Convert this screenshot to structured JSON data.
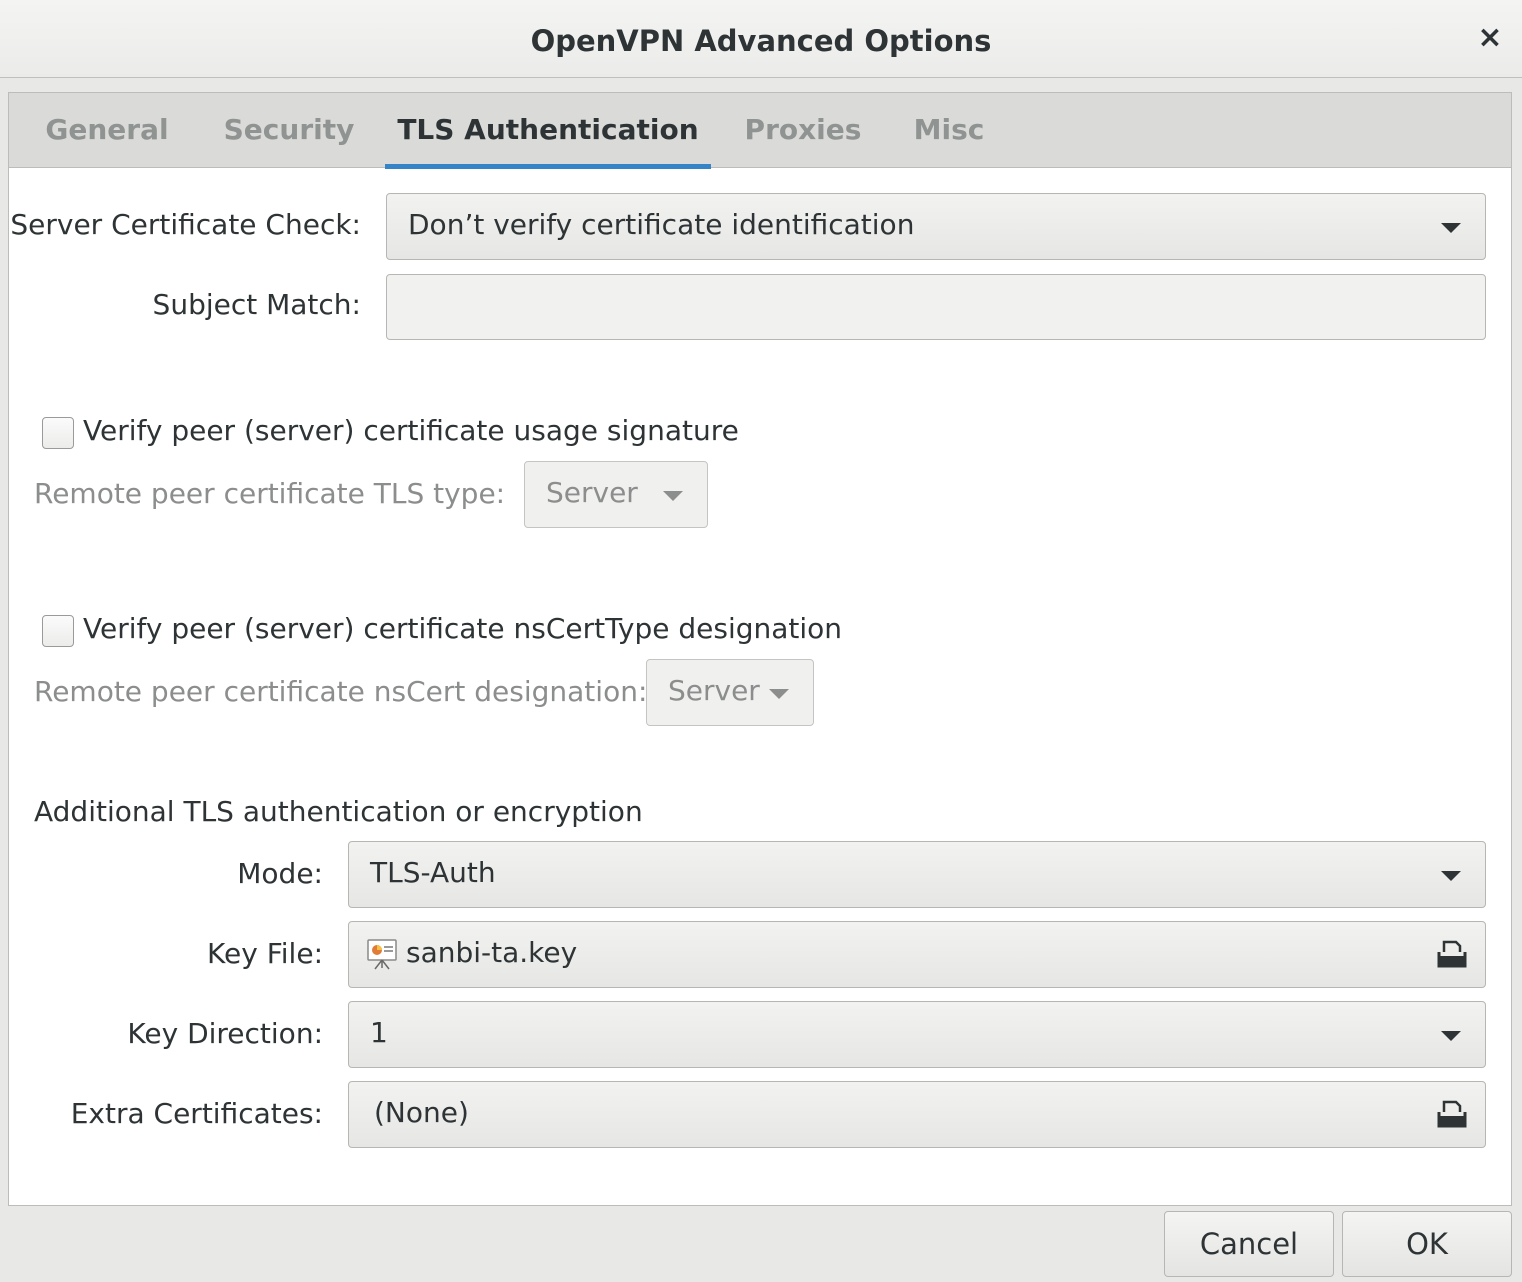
{
  "window": {
    "title": "OpenVPN Advanced Options",
    "close_glyph": "×"
  },
  "tabs": [
    {
      "label": "General",
      "active": false
    },
    {
      "label": "Security",
      "active": false
    },
    {
      "label": "TLS Authentication",
      "active": true
    },
    {
      "label": "Proxies",
      "active": false
    },
    {
      "label": "Misc",
      "active": false
    }
  ],
  "form": {
    "server_cert_check_label": "Server Certificate Check:",
    "server_cert_check_value": "Don’t verify certificate identification",
    "subject_match_label": "Subject Match:",
    "subject_match_value": "",
    "verify_usage_label": "Verify peer (server) certificate usage signature",
    "verify_usage_checked": false,
    "remote_tls_type_label": "Remote peer certificate TLS type:",
    "remote_tls_type_value": "Server",
    "verify_nscert_label": "Verify peer (server) certificate nsCertType designation",
    "verify_nscert_checked": false,
    "remote_nscert_label": "Remote peer certificate nsCert designation:",
    "remote_nscert_value": "Server",
    "additional_section_title": "Additional TLS authentication or encryption",
    "mode_label": "Mode:",
    "mode_value": "TLS-Auth",
    "key_file_label": "Key File:",
    "key_file_value": "sanbi-ta.key",
    "key_direction_label": "Key Direction:",
    "key_direction_value": "1",
    "extra_certs_label": "Extra Certificates:",
    "extra_certs_value": "(None)"
  },
  "buttons": {
    "cancel": "Cancel",
    "ok": "OK"
  },
  "colors": {
    "accent": "#3584c8",
    "tabbar_bg": "#dadad8",
    "window_bg": "#e8e8e7"
  }
}
